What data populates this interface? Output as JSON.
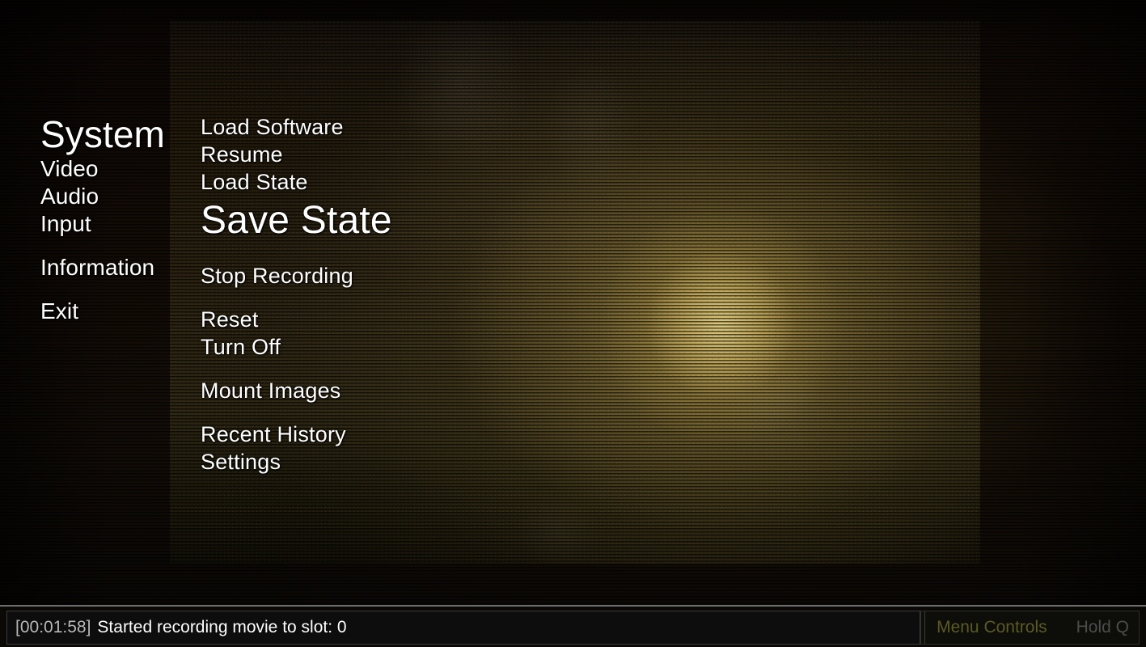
{
  "app": {
    "title": "System"
  },
  "sidebar": {
    "items": [
      {
        "label": "System",
        "selected": true,
        "gap": false
      },
      {
        "label": "Video",
        "selected": false,
        "gap": false
      },
      {
        "label": "Audio",
        "selected": false,
        "gap": false
      },
      {
        "label": "Input",
        "selected": false,
        "gap": false
      },
      {
        "label": "Information",
        "selected": false,
        "gap": true
      },
      {
        "label": "Exit",
        "selected": false,
        "gap": true
      }
    ]
  },
  "menu": {
    "items": [
      {
        "label": "Load Software",
        "selected": false,
        "gap": "none"
      },
      {
        "label": "Resume",
        "selected": false,
        "gap": "none"
      },
      {
        "label": "Load State",
        "selected": false,
        "gap": "none"
      },
      {
        "label": "Save State",
        "selected": true,
        "gap": "none"
      },
      {
        "label": "Stop Recording",
        "selected": false,
        "gap": "lg"
      },
      {
        "label": "Reset",
        "selected": false,
        "gap": "lg"
      },
      {
        "label": "Turn Off",
        "selected": false,
        "gap": "none"
      },
      {
        "label": "Mount Images",
        "selected": false,
        "gap": "lg"
      },
      {
        "label": "Recent History",
        "selected": false,
        "gap": "lg"
      },
      {
        "label": "Settings",
        "selected": false,
        "gap": "none"
      }
    ]
  },
  "status": {
    "timestamp": "[00:01:58]",
    "message": "Started recording movie to slot: 0",
    "menu_controls_label": "Menu Controls",
    "hold_key_label": "Hold Q"
  },
  "colors": {
    "text": "#ffffff",
    "status_time": "#b9b9b9",
    "menu_controls": "#5c5a24",
    "hold_key": "#4c4c4a",
    "glow": "#c9b05a",
    "background": "#0a0605"
  }
}
